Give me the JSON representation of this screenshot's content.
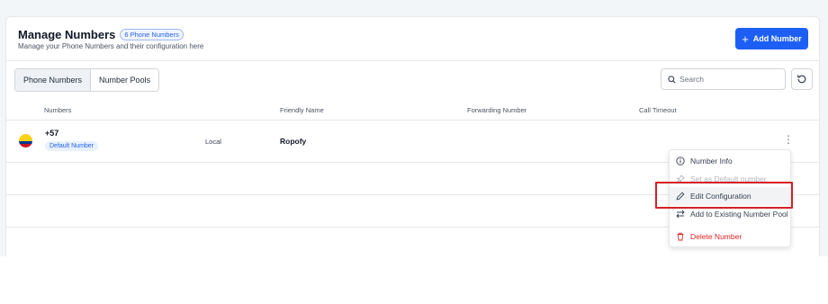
{
  "header": {
    "title": "Manage Numbers",
    "count_badge": "6 Phone Numbers",
    "subtitle": "Manage your Phone Numbers and their configuration here",
    "add_button": "Add Number"
  },
  "tabs": [
    {
      "label": "Phone Numbers",
      "active": true
    },
    {
      "label": "Number Pools",
      "active": false
    }
  ],
  "search": {
    "placeholder": "Search",
    "value": ""
  },
  "table": {
    "columns": [
      "Numbers",
      "Friendly Name",
      "Forwarding Number",
      "Call Timeout"
    ],
    "rows": [
      {
        "number": "+57",
        "badge": "Default Number",
        "type": "Local",
        "friendly_name": "Ropofy",
        "forwarding_number": "",
        "call_timeout": "",
        "flag": "colombia-flag-icon"
      }
    ]
  },
  "menu": {
    "items": [
      {
        "label": "Number Info",
        "icon": "info-icon",
        "state": "normal"
      },
      {
        "label": "Set as Default number",
        "icon": "pin-icon",
        "state": "disabled"
      },
      {
        "label": "Edit Configuration",
        "icon": "pencil-icon",
        "state": "hover"
      },
      {
        "label": "Add to Existing Number Pool",
        "icon": "transfer-icon",
        "state": "normal"
      },
      {
        "label": "Delete Number",
        "icon": "trash-icon",
        "state": "danger"
      }
    ]
  },
  "colors": {
    "accent": "#1d5ff5",
    "danger": "#dc2626",
    "highlight_box": "#d71f27"
  }
}
